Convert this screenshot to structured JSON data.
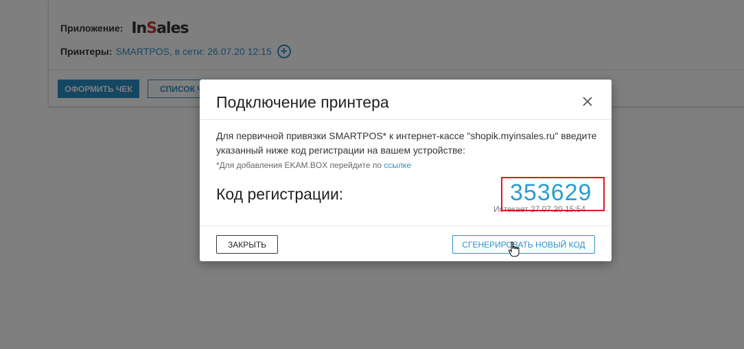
{
  "background": {
    "app_label": "Приложение:",
    "app_logo": {
      "part1": "In",
      "part2": "S",
      "part3": "ales"
    },
    "printers_label": "Принтеры:",
    "printers_value": "SMARTPOS, в сети: 26.07.20 12:15",
    "checkout_button": "ОФОРМИТЬ ЧЕК",
    "list_button": "СПИСОК Ч"
  },
  "modal": {
    "title": "Подключение принтера",
    "description": "Для первичной привязки SMARTPOS* к интернет-кассе \"shopik.myinsales.ru\" введите указанный ниже код регистрации на вашем устройстве:",
    "note_prefix": "*Для добавления EKAM.BOX перейдите по ",
    "note_link": "ссылке",
    "code_label": "Код регистрации:",
    "code_value": "353629",
    "expires": "Истекает 27.07.20 15:54",
    "close_button": "ЗАКРЫТЬ",
    "generate_button": "СГЕНЕРИРОВАТЬ НОВЫЙ КОД"
  },
  "colors": {
    "accent": "#2a8fc7",
    "code": "#2a9bd1",
    "highlight_border": "#e0141b",
    "overlay": "rgba(0,0,0,0.5)"
  }
}
